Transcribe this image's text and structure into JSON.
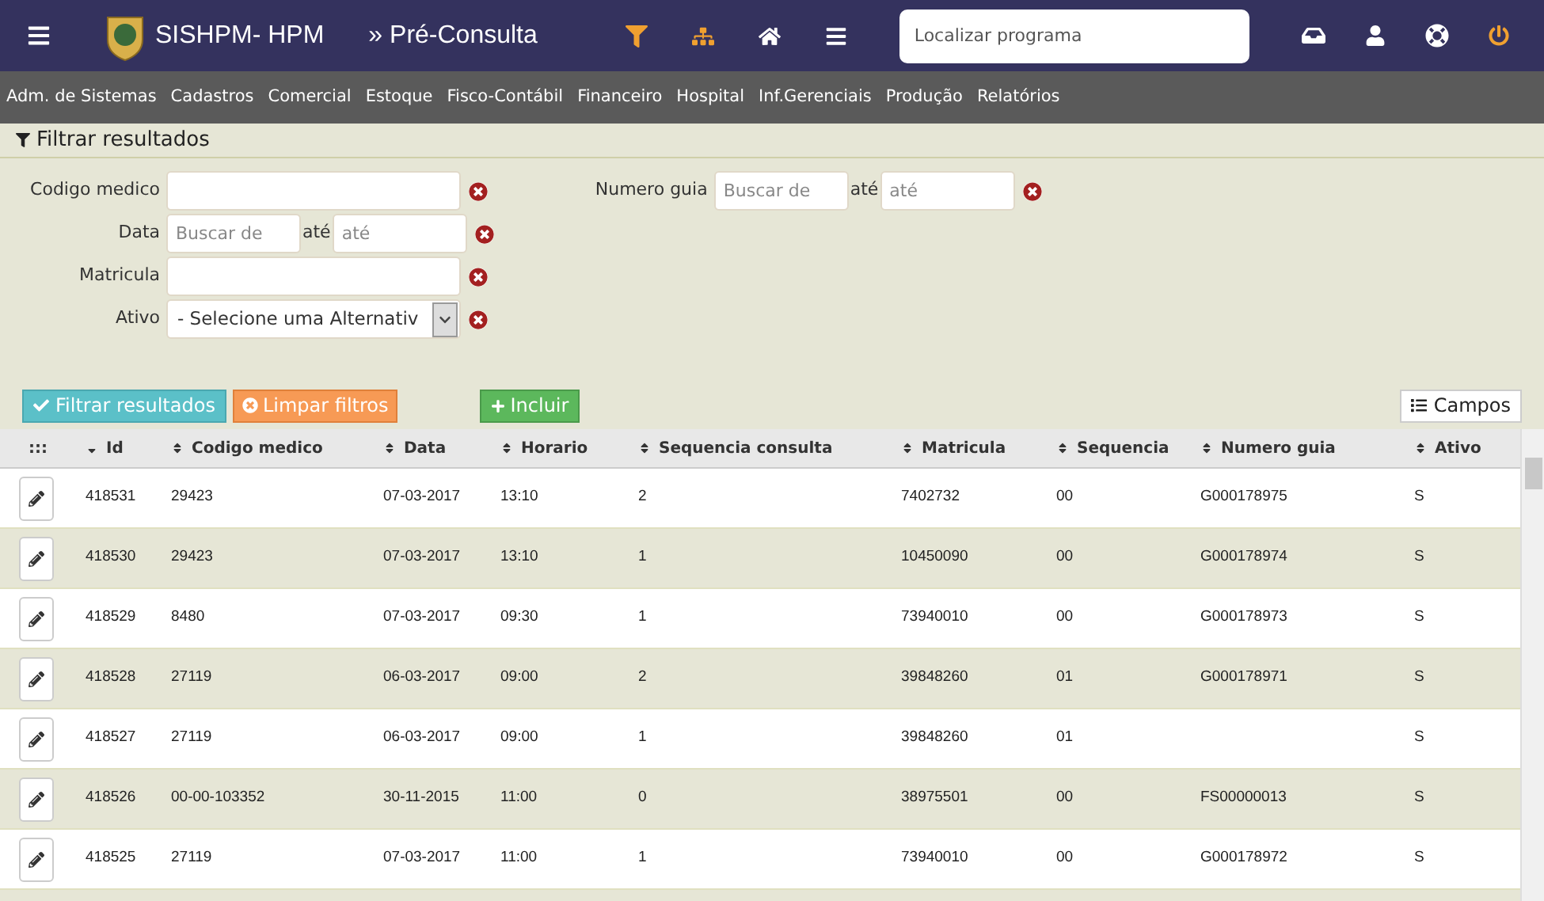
{
  "header": {
    "title": "SISHPM- HPM",
    "page": "» Pré-Consulta",
    "search": {
      "placeholder": "Localizar programa"
    }
  },
  "menu": [
    "Adm. de Sistemas",
    "Cadastros",
    "Comercial",
    "Estoque",
    "Fisco-Contábil",
    "Financeiro",
    "Hospital",
    "Inf.Gerenciais",
    "Produção",
    "Relatórios"
  ],
  "filter": {
    "title": "Filtrar resultados",
    "fields": [
      {
        "kind": "text",
        "label": "Codigo medico"
      },
      {
        "kind": "range",
        "label": "Data",
        "from_placeholder": "Buscar de",
        "between": "até",
        "to_placeholder": "até"
      },
      {
        "kind": "text",
        "label": "Matricula"
      },
      {
        "kind": "select",
        "label": "Ativo",
        "value": "- Selecione uma Alternativ"
      }
    ],
    "side_fields": [
      {
        "kind": "range",
        "label": "Numero guia",
        "from_placeholder": "Buscar de",
        "between": "até",
        "to_placeholder": "até"
      }
    ]
  },
  "actions": {
    "filter": "Filtrar resultados",
    "clear": "Limpar filtros",
    "add": "Incluir",
    "fields": "Campos"
  },
  "table": {
    "handle": ":::",
    "columns": [
      {
        "label": "Id",
        "sorted": true
      },
      {
        "label": "Codigo medico",
        "sorted": false
      },
      {
        "label": "Data",
        "sorted": false
      },
      {
        "label": "Horario",
        "sorted": false
      },
      {
        "label": "Sequencia consulta",
        "sorted": false
      },
      {
        "label": "Matricula",
        "sorted": false
      },
      {
        "label": "Sequencia",
        "sorted": false
      },
      {
        "label": "Numero guia",
        "sorted": false
      },
      {
        "label": "Ativo",
        "sorted": false
      }
    ],
    "rows": [
      [
        "418531",
        "29423",
        "07-03-2017",
        "13:10",
        "2",
        "7402732",
        "00",
        "G000178975",
        "S"
      ],
      [
        "418530",
        "29423",
        "07-03-2017",
        "13:10",
        "1",
        "10450090",
        "00",
        "G000178974",
        "S"
      ],
      [
        "418529",
        "8480",
        "07-03-2017",
        "09:30",
        "1",
        "73940010",
        "00",
        "G000178973",
        "S"
      ],
      [
        "418528",
        "27119",
        "06-03-2017",
        "09:00",
        "2",
        "39848260",
        "01",
        "G000178971",
        "S"
      ],
      [
        "418527",
        "27119",
        "06-03-2017",
        "09:00",
        "1",
        "39848260",
        "01",
        "",
        "S"
      ],
      [
        "418526",
        "00-00-103352",
        "30-11-2015",
        "11:00",
        "0",
        "38975501",
        "00",
        "FS00000013",
        "S"
      ],
      [
        "418525",
        "27119",
        "07-03-2017",
        "11:00",
        "1",
        "73940010",
        "00",
        "G000178972",
        "S"
      ]
    ]
  }
}
